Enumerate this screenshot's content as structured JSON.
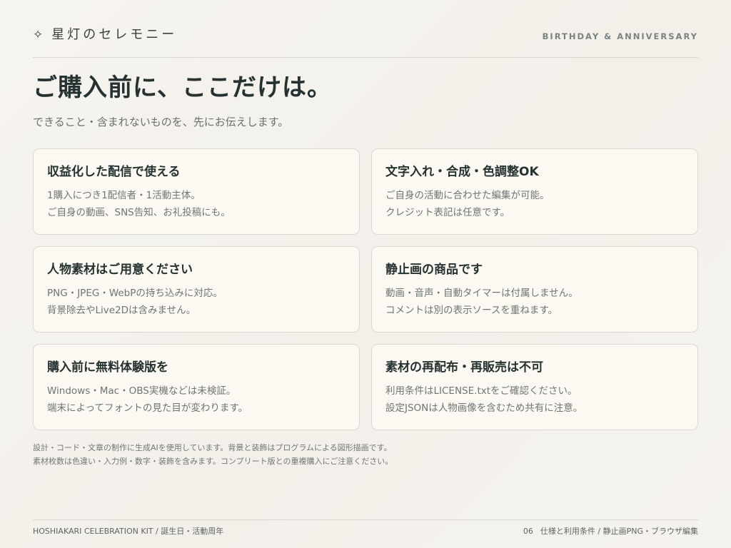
{
  "header": {
    "brand_icon": "✧",
    "brand_name": "星灯のセレモニー",
    "tagline": "BIRTHDAY & ANNIVERSARY"
  },
  "main": {
    "title": "ご購入前に、ここだけは。",
    "subtitle": "できること・含まれないものを、先にお伝えします。",
    "cards": [
      {
        "title": "収益化した配信で使える",
        "lines": [
          "1購入につき1配信者・1活動主体。",
          "ご自身の動画、SNS告知、お礼投稿にも。"
        ]
      },
      {
        "title": "文字入れ・合成・色調整OK",
        "lines": [
          "ご自身の活動に合わせた編集が可能。",
          "クレジット表記は任意です。"
        ]
      },
      {
        "title": "人物素材はご用意ください",
        "lines": [
          "PNG・JPEG・WebPの持ち込みに対応。",
          "背景除去やLive2Dは含みません。"
        ]
      },
      {
        "title": "静止画の商品です",
        "lines": [
          "動画・音声・自動タイマーは付属しません。",
          "コメントは別の表示ソースを重ねます。"
        ]
      },
      {
        "title": "購入前に無料体験版を",
        "lines": [
          "Windows・Mac・OBS実機などは未検証。",
          "端末によってフォントの見た目が変わります。"
        ]
      },
      {
        "title": "素材の再配布・再販売は不可",
        "lines": [
          "利用条件はLICENSE.txtをご確認ください。",
          "設定JSONは人物画像を含むため共有に注意。"
        ]
      }
    ],
    "notes": [
      "設計・コード・文章の制作に生成AIを使用しています。背景と装飾はプログラムによる図形描画です。",
      "素材枚数は色違い・入力例・数字・装飾を含みます。コンプリート版との重複購入にご注意ください。"
    ]
  },
  "footer": {
    "left": "HOSHIAKARI CELEBRATION KIT / 誕生日・活動周年",
    "page_number": "06",
    "section": "仕様と利用条件 / 静止画PNG・ブラウザ編集"
  }
}
